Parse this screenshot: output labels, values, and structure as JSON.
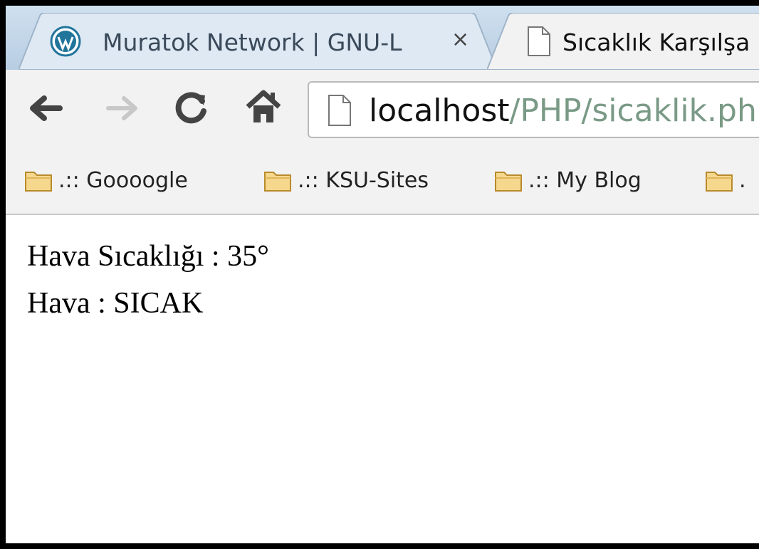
{
  "tabs": [
    {
      "title": "Muratok Network | GNU-L",
      "icon": "wordpress-icon",
      "close": "×"
    },
    {
      "title": "Sıcaklık Karşılşa",
      "icon": "page-icon"
    }
  ],
  "toolbar": {
    "back_icon": "back-arrow-icon",
    "forward_icon": "forward-arrow-icon",
    "reload_icon": "reload-icon",
    "home_icon": "home-icon",
    "url_host": "localhost",
    "url_path": "/PHP/sicaklik.ph"
  },
  "bookmarks": [
    {
      "label": ".:: Goooogle",
      "icon": "folder-icon"
    },
    {
      "label": ".:: KSU-Sites",
      "icon": "folder-icon"
    },
    {
      "label": ".:: My Blog",
      "icon": "folder-icon"
    },
    {
      "label": ".",
      "icon": "folder-icon"
    }
  ],
  "content": {
    "line1": "Hava Sıcaklığı : 35°",
    "line2": "Hava : SICAK"
  },
  "colors": {
    "tabstrip": "#c3d6e8",
    "toolbar": "#f2f2f2",
    "url_path": "#7a9a86"
  }
}
